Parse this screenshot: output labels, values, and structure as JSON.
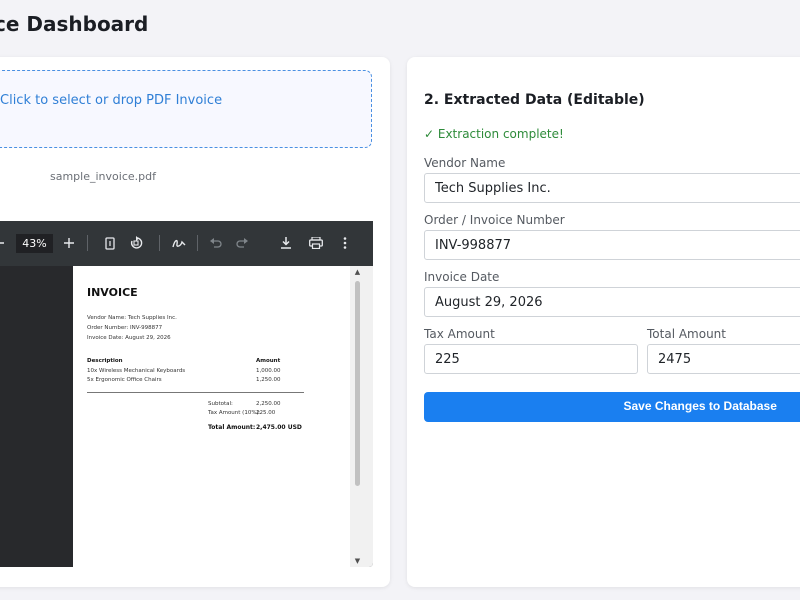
{
  "header": {
    "title": "ce Dashboard"
  },
  "upload": {
    "prompt": "Click to select or drop PDF Invoice",
    "file_name": "sample_invoice.pdf"
  },
  "viewer": {
    "zoom": "43%",
    "icons": [
      "minus-icon",
      "plus-icon",
      "fit-page-icon",
      "rotate-icon",
      "annotate-icon",
      "undo-icon",
      "redo-icon",
      "download-icon",
      "print-icon",
      "more-icon"
    ],
    "invoice": {
      "title": "INVOICE",
      "vendor_line": "Vendor Name: Tech Supplies Inc.",
      "order_line": "Order Number: INV-998877",
      "date_line": "Invoice Date: August 29, 2026",
      "col_description": "Description",
      "col_amount": "Amount",
      "items": [
        {
          "description": "10x Wireless Mechanical Keyboards",
          "amount": "1,000.00"
        },
        {
          "description": "5x Ergonomic Office Chairs",
          "amount": "1,250.00"
        }
      ],
      "subtotal_label": "Subtotal:",
      "subtotal_value": "2,250.00",
      "tax_label": "Tax Amount (10%):",
      "tax_value": "225.00",
      "total_label": "Total Amount:",
      "total_value": "2,475.00 USD"
    }
  },
  "form": {
    "section_title": "2. Extracted Data (Editable)",
    "status": "✓ Extraction complete!",
    "vendor_label": "Vendor Name",
    "vendor_value": "Tech Supplies Inc.",
    "invoice_number_label": "Order / Invoice Number",
    "invoice_number_value": "INV-998877",
    "date_label": "Invoice Date",
    "date_value": "August 29, 2026",
    "tax_label": "Tax Amount",
    "tax_value": "225",
    "total_label": "Total Amount",
    "total_value": "2475",
    "save_label": "Save Changes to Database"
  },
  "colors": {
    "accent": "#1a7ff0",
    "success": "#2e8b3a",
    "viewer_bg": "#323639"
  }
}
